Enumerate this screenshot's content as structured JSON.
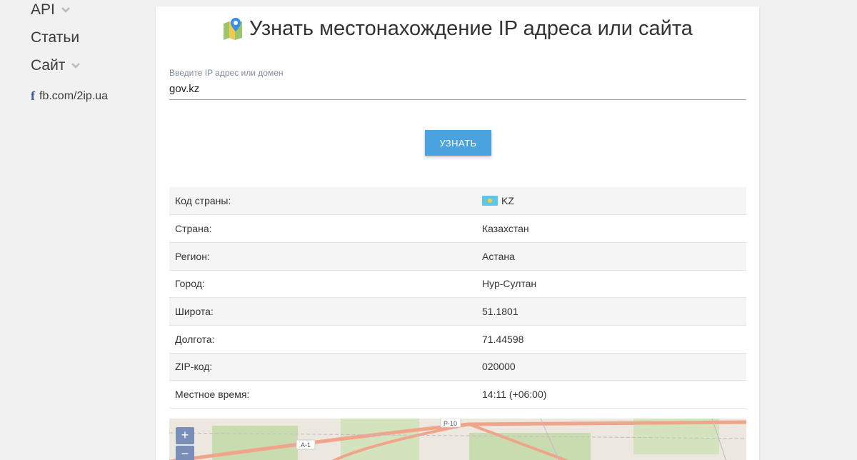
{
  "sidebar": {
    "items": [
      {
        "label": "API",
        "has_dropdown": true
      },
      {
        "label": "Статьи",
        "has_dropdown": false
      },
      {
        "label": "Сайт",
        "has_dropdown": true
      }
    ],
    "facebook": {
      "icon": "facebook-icon",
      "label": "fb.com/2ip.ua"
    }
  },
  "main": {
    "title": "Узнать местонахождение IP адреса или сайта",
    "title_icon": "map-pin-icon",
    "input": {
      "label": "Введите IP адрес или домен",
      "value": "gov.kz"
    },
    "submit_label": "УЗНАТЬ",
    "results": [
      {
        "key": "Код страны:",
        "value": "KZ",
        "flag": "kazakhstan-flag-icon"
      },
      {
        "key": "Страна:",
        "value": "Казахстан"
      },
      {
        "key": "Регион:",
        "value": "Астана"
      },
      {
        "key": "Город:",
        "value": "Нур-Султан"
      },
      {
        "key": "Широта:",
        "value": "51.1801"
      },
      {
        "key": "Долгота:",
        "value": "71.44598"
      },
      {
        "key": "ZIP-код:",
        "value": "020000"
      },
      {
        "key": "Местное время:",
        "value": "14:11 (+06:00)"
      }
    ],
    "map": {
      "zoom_in": "+",
      "zoom_out": "−",
      "road_labels": [
        "P-10",
        "A-1"
      ]
    }
  },
  "colors": {
    "accent": "#4aa3df",
    "background": "#f1f1f1",
    "row_alt": "#f5f5f5"
  }
}
